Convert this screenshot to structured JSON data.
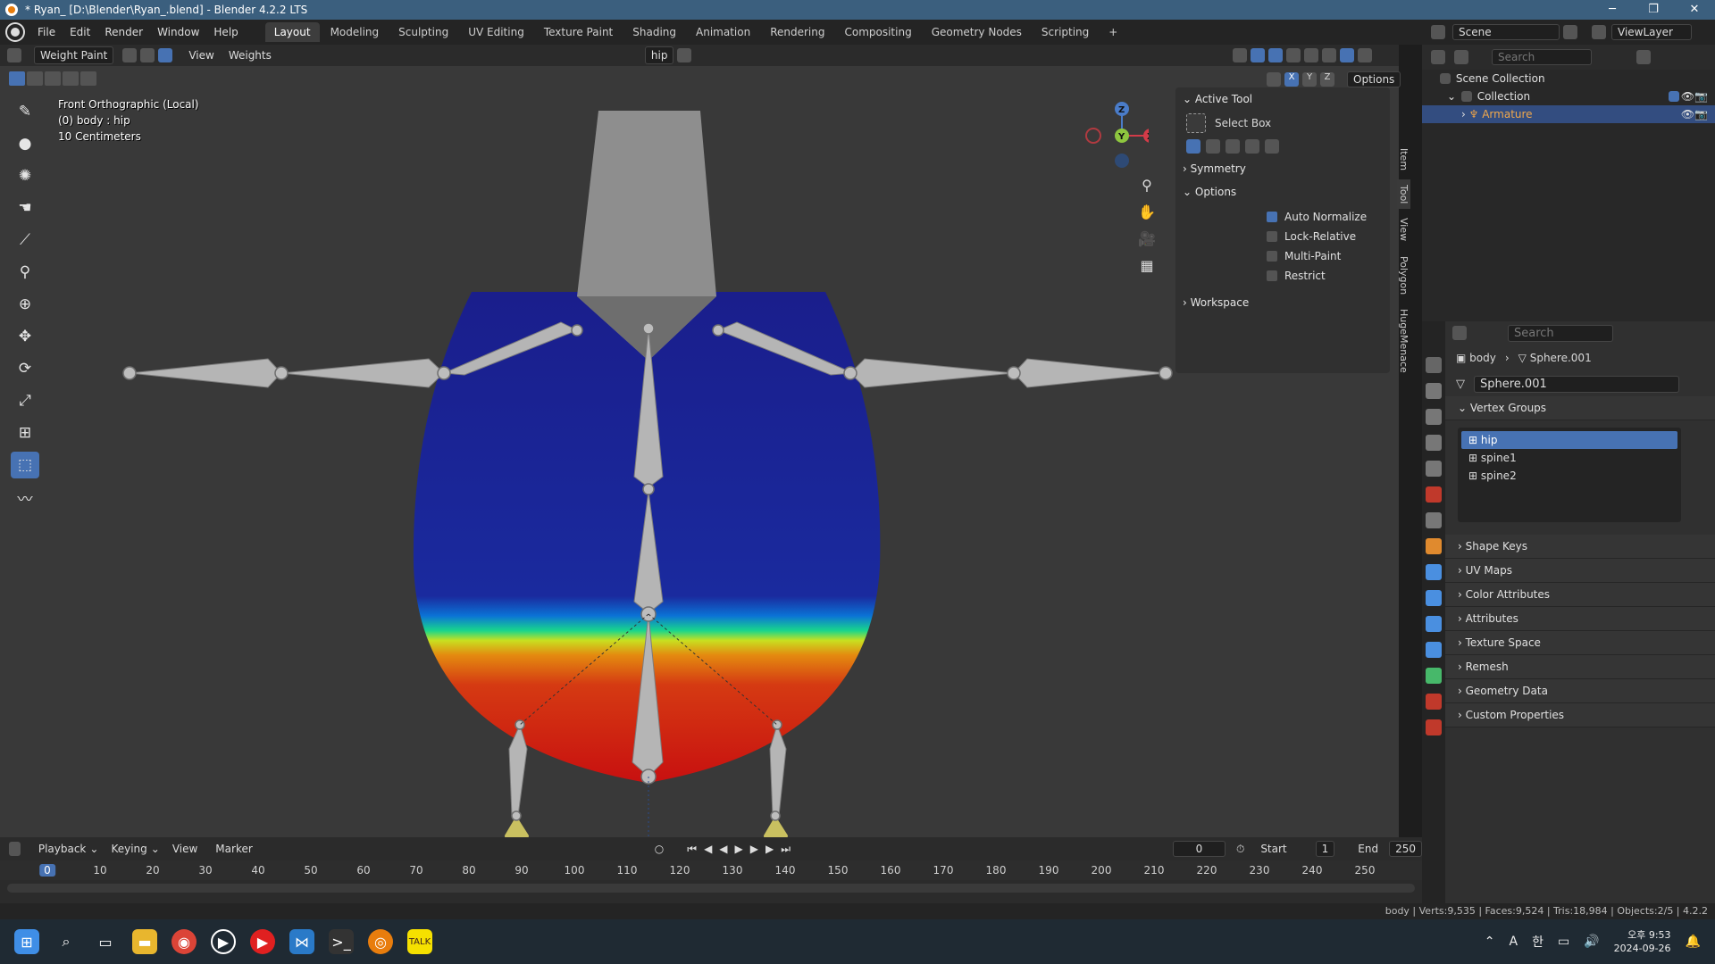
{
  "window": {
    "title": "* Ryan_ [D:\\Blender\\Ryan_.blend] - Blender 4.2.2 LTS",
    "controls": [
      "─",
      "❐",
      "✕"
    ]
  },
  "menu": [
    "File",
    "Edit",
    "Render",
    "Window",
    "Help"
  ],
  "workspaces": [
    "Layout",
    "Modeling",
    "Sculpting",
    "UV Editing",
    "Texture Paint",
    "Shading",
    "Animation",
    "Rendering",
    "Compositing",
    "Geometry Nodes",
    "Scripting"
  ],
  "workspace_add": "+",
  "scene": {
    "label": "Scene",
    "view_layer": "ViewLayer"
  },
  "viewport": {
    "mode": "Weight Paint",
    "menus": [
      "View",
      "Weights"
    ],
    "vgroup": "hip",
    "options_label": "Options",
    "info": [
      "Front Orthographic (Local)",
      "(0) body : hip",
      "10 Centimeters"
    ],
    "axes": [
      "X",
      "Y",
      "Z"
    ]
  },
  "gizmo": {
    "z": "Z",
    "y": "Y",
    "x": "X"
  },
  "tool_panel": {
    "active_tool_header": "Active Tool",
    "tool_name": "Select Box",
    "symmetry": "Symmetry",
    "options": "Options",
    "checks": [
      {
        "label": "Auto Normalize",
        "on": true
      },
      {
        "label": "Lock-Relative",
        "on": false
      },
      {
        "label": "Multi-Paint",
        "on": false
      },
      {
        "label": "Restrict",
        "on": false
      }
    ],
    "workspace": "Workspace"
  },
  "side_tabs": [
    "Item",
    "Tool",
    "View",
    "Polygon",
    "HugeMenace"
  ],
  "outliner": {
    "search_placeholder": "Search",
    "rows": [
      {
        "label": "Scene Collection"
      },
      {
        "label": "Collection"
      },
      {
        "label": "Armature"
      }
    ]
  },
  "properties": {
    "search_placeholder": "Search",
    "breadcrumb": [
      "body",
      "Sphere.001"
    ],
    "data_name": "Sphere.001",
    "vertex_groups_header": "Vertex Groups",
    "vertex_groups": [
      "hip",
      "spine1",
      "spine2"
    ],
    "sections": [
      "Shape Keys",
      "UV Maps",
      "Color Attributes",
      "Attributes",
      "Texture Space",
      "Remesh",
      "Geometry Data",
      "Custom Properties"
    ]
  },
  "timeline": {
    "menus": [
      "Playback",
      "Keying",
      "View",
      "Marker"
    ],
    "current": "0",
    "start_label": "Start",
    "start": "1",
    "end_label": "End",
    "end": "250",
    "frames": [
      "0",
      "10",
      "20",
      "30",
      "40",
      "50",
      "60",
      "70",
      "80",
      "90",
      "100",
      "110",
      "120",
      "130",
      "140",
      "150",
      "160",
      "170",
      "180",
      "190",
      "200",
      "210",
      "220",
      "230",
      "240",
      "250"
    ]
  },
  "status": "body | Verts:9,535 | Faces:9,524 | Tris:18,984 | Objects:2/5 | 4.2.2",
  "taskbar": {
    "time": "오후 9:53",
    "date": "2024-09-26",
    "ime": "A",
    "lang": "한"
  }
}
